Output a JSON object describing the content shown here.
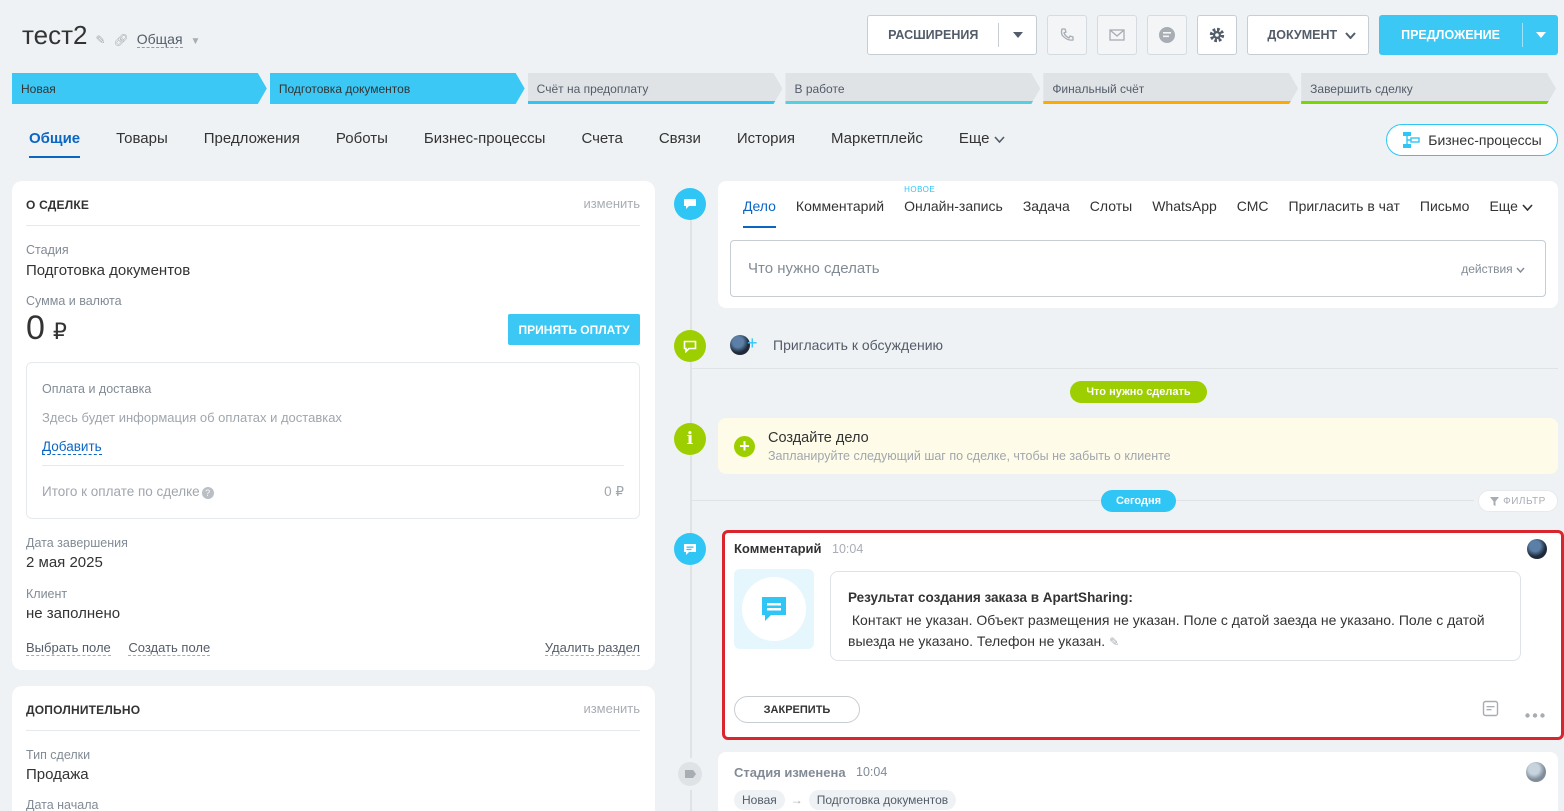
{
  "header": {
    "deal_name": "тест2",
    "category": "Общая",
    "extensions_label": "РАСШИРЕНИЯ",
    "document_label": "ДОКУМЕНТ",
    "proposal_label": "ПРЕДЛОЖЕНИЕ",
    "icons": [
      "phone-icon",
      "mail-icon",
      "chat-icon",
      "gear-icon"
    ]
  },
  "stages": [
    {
      "label": "Новая",
      "active": true,
      "color": "#3bc8f5"
    },
    {
      "label": "Подготовка документов",
      "active": true,
      "color": "#3bc8f5"
    },
    {
      "label": "Счёт на предоплату",
      "active": false,
      "color": "#2fc6f6"
    },
    {
      "label": "В работе",
      "active": false,
      "color": "#55d0e0"
    },
    {
      "label": "Финальный счёт",
      "active": false,
      "color": "#ffa900"
    },
    {
      "label": "Завершить сделку",
      "active": false,
      "color": "#7bd500"
    }
  ],
  "tabs": [
    "Общие",
    "Товары",
    "Предложения",
    "Роботы",
    "Бизнес-процессы",
    "Счета",
    "Связи",
    "История",
    "Маркетплейс",
    "Еще"
  ],
  "bp_button": "Бизнес-процессы",
  "about": {
    "title": "О СДЕЛКЕ",
    "edit": "изменить",
    "stage_label": "Стадия",
    "stage_value": "Подготовка документов",
    "sum_label": "Сумма и валюта",
    "sum_value": "0",
    "currency": "₽",
    "pay_button": "ПРИНЯТЬ ОПЛАТУ",
    "payment": {
      "title": "Оплата и доставка",
      "info": "Здесь будет информация об оплатах и доставках",
      "add": "Добавить",
      "total_label": "Итого к оплате по сделке",
      "total_value": "0 ₽"
    },
    "close_date_label": "Дата завершения",
    "close_date_value": "2 мая 2025",
    "client_label": "Клиент",
    "client_value": "не заполнено",
    "select_field": "Выбрать поле",
    "create_field": "Создать поле",
    "delete_section": "Удалить раздел"
  },
  "extra": {
    "title": "ДОПОЛНИТЕЛЬНО",
    "edit": "изменить",
    "type_label": "Тип сделки",
    "type_value": "Продажа",
    "start_label": "Дата начала"
  },
  "activity": {
    "tabs": [
      "Дело",
      "Комментарий",
      "Онлайн-запись",
      "Задача",
      "Слоты",
      "WhatsApp",
      "СМС",
      "Пригласить в чат",
      "Письмо",
      "Еще"
    ],
    "new_badge": "НОВОЕ",
    "placeholder": "Что нужно сделать",
    "actions": "действия"
  },
  "invite": "Пригласить к обсуждению",
  "todo_pill": "Что нужно сделать",
  "create_task": {
    "title": "Создайте дело",
    "subtitle": "Запланируйте следующий шаг по сделке, чтобы не забыть о клиенте"
  },
  "today_pill": "Сегодня",
  "filter": "ФИЛЬТР",
  "comment": {
    "title": "Комментарий",
    "time": "10:04",
    "result_title": "Результат создания заказа в ApartSharing:",
    "result_text": "Контакт не указан. Объект размещения не указан. Поле с датой заезда не указано. Поле с датой выезда не указано. Телефон не указан.",
    "pin": "ЗАКРЕПИТЬ"
  },
  "stage_changed": {
    "title": "Стадия изменена",
    "time": "10:04",
    "from": "Новая",
    "to": "Подготовка документов"
  }
}
